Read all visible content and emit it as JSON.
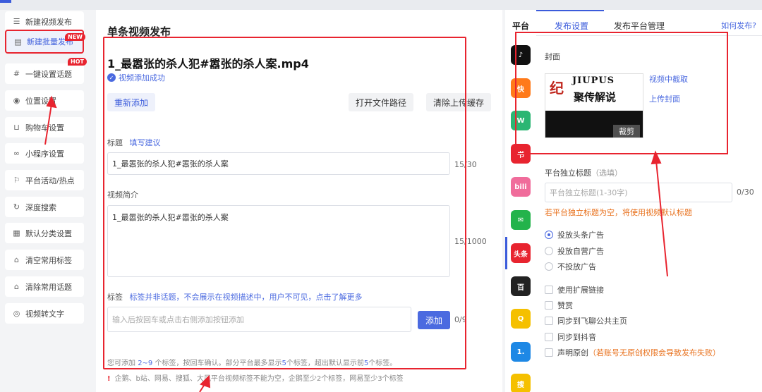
{
  "sidebar": {
    "items": [
      {
        "label": "新建视频发布",
        "icon": "plus-list-icon"
      },
      {
        "label": "新建批量发布",
        "icon": "batch-icon",
        "badge": "NEW"
      },
      {
        "label": "一键设置话题",
        "icon": "hash-icon",
        "badge": "HOT"
      },
      {
        "label": "位置设置",
        "icon": "location-icon"
      },
      {
        "label": "购物车设置",
        "icon": "cart-icon"
      },
      {
        "label": "小程序设置",
        "icon": "miniapp-icon"
      },
      {
        "label": "平台活动/热点",
        "icon": "flag-icon"
      },
      {
        "label": "深度搜索",
        "icon": "search-icon"
      },
      {
        "label": "默认分类设置",
        "icon": "grid-icon"
      },
      {
        "label": "清空常用标签",
        "icon": "tag-icon"
      },
      {
        "label": "清除常用话题",
        "icon": "tag-icon"
      },
      {
        "label": "视频转文字",
        "icon": "convert-icon"
      }
    ]
  },
  "main": {
    "title": "单条视频发布",
    "filename": "1_最嚣张的杀人犯#嚣张的杀人案.mp4",
    "upload_status": "视频添加成功",
    "readd": "重新添加",
    "open_path": "打开文件路径",
    "clear_cache": "清除上传缓存",
    "title_label": "标题",
    "title_suggest": "填写建议",
    "title_value": "1_最嚣张的杀人犯#嚣张的杀人案",
    "title_count": "15/30",
    "desc_label": "视频简介",
    "desc_value": "1_最嚣张的杀人犯#嚣张的杀人案",
    "desc_count": "15/1000",
    "tag_label": "标签",
    "tag_note": "标签并非话题，不会展示在视频描述中，用户不可见，点击了解更多",
    "tag_placeholder": "输入后按回车或点击右侧添加按钮添加",
    "tag_add": "添加",
    "tag_count": "0/9",
    "hint_a": "您可添加 ",
    "hint_b": "2~9",
    "hint_c": " 个标签，按回车确认。部分平台最多显示",
    "hint_d": "5",
    "hint_e": "个标签，超出默认显示前",
    "hint_f": "5",
    "hint_g": "个标签。",
    "warn_mark": "!",
    "warn": "企鹅、b站、网易、搜狐、大风平台视频标签不能为空，企鹅至少2个标签，网易至少3个标签"
  },
  "platforms": {
    "heading": "平台",
    "items": [
      {
        "name": "douyin-icon",
        "glyph": "♪",
        "color": "#111111"
      },
      {
        "name": "kuaishou-icon",
        "glyph": "快",
        "color": "#ff7a1a"
      },
      {
        "name": "xigua-icon",
        "glyph": "W",
        "color": "#2bb673"
      },
      {
        "name": "xiaohongshu-icon",
        "glyph": "书",
        "color": "#e8242f"
      },
      {
        "name": "bilibili-icon",
        "glyph": "bili",
        "color": "#f06c9b"
      },
      {
        "name": "wechat-icon",
        "glyph": "✉",
        "color": "#23b34b"
      },
      {
        "name": "toutiao-icon",
        "glyph": "头条",
        "color": "#e8242f"
      },
      {
        "name": "baijiahao-icon",
        "glyph": "百",
        "color": "#222222"
      },
      {
        "name": "qq-icon",
        "glyph": "Q",
        "color": "#f5c000"
      },
      {
        "name": "yidian-icon",
        "glyph": "1.",
        "color": "#1e88e5"
      },
      {
        "name": "sohu-icon",
        "glyph": "搜",
        "color": "#f5c000"
      }
    ]
  },
  "right": {
    "tab_settings": "发布设置",
    "tab_manage": "发布平台管理",
    "how": "如何发布?",
    "cover_label": "封面",
    "cover_capture": "视频中截取",
    "cover_upload": "上传封面",
    "cover_crop": "裁剪",
    "cover_brand1": "纪",
    "cover_brand2": "JIUPUS",
    "cover_brand3": "聚传解说",
    "independent_label": "平台独立标题",
    "independent_optional": "（选填）",
    "independent_placeholder": "平台独立标题(1-30字)",
    "independent_count": "0/30",
    "independent_note": "若平台独立标题为空，将使用视频默认标题",
    "radio_1": "投放头条广告",
    "radio_2": "投放自营广告",
    "radio_3": "不投放广告",
    "check_1": "使用扩展链接",
    "check_2": "赞赏",
    "check_3": "同步到飞聊公共主页",
    "check_4": "同步到抖音",
    "check_5": "声明原创",
    "check_5_note": "（若账号无原创权限会导致发布失败）"
  },
  "colors": {
    "accent": "#4b6ae0",
    "highlight": "#e8242f",
    "orange": "#e8711d"
  }
}
